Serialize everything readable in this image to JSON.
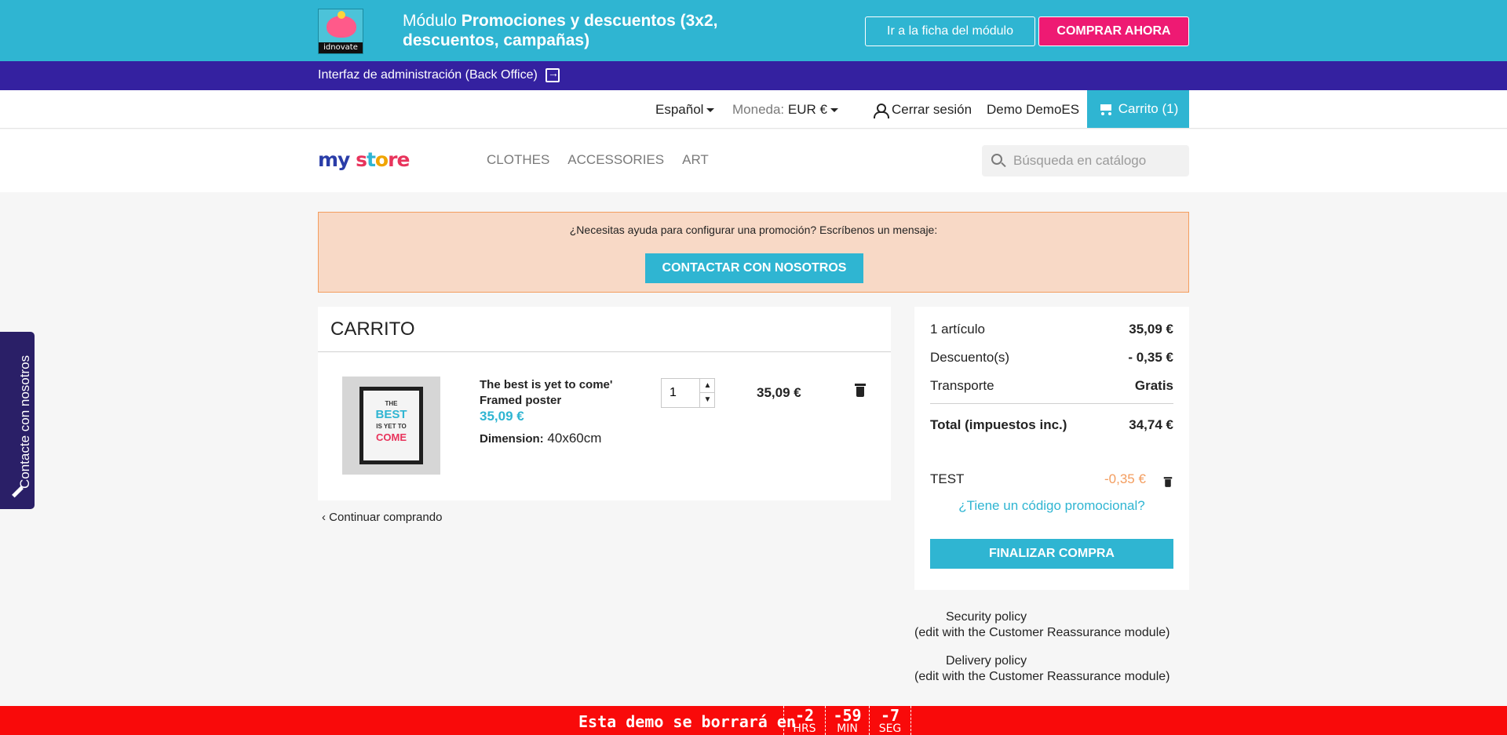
{
  "demo_banner": {
    "module_logo_text": "idnovate",
    "title_prefix": "Módulo ",
    "title_bold": "Promociones y descuentos (3x2, descuentos, campañas)",
    "module_button": "Ir a la ficha del módulo",
    "buy_button": "COMPRAR AHORA"
  },
  "backoffice": {
    "label": "Interfaz de administración (Back Office)"
  },
  "nav": {
    "language": "Español",
    "currency_label": "Moneda:",
    "currency_value": "EUR €",
    "logout": "Cerrar sesión",
    "account": "Demo DemoES",
    "cart": "Carrito (1)"
  },
  "header": {
    "logo_my": "my",
    "logo_s": "s",
    "logo_t": "t",
    "logo_o": "o",
    "logo_re": "re",
    "menu": [
      "CLOTHES",
      "ACCESSORIES",
      "ART"
    ],
    "search_placeholder": "Búsqueda en catálogo"
  },
  "help": {
    "message": "¿Necesitas ayuda para configurar una promoción? Escríbenos un mensaje:",
    "button": "CONTACTAR CON NOSOTROS"
  },
  "cart": {
    "title": "CARRITO",
    "items": [
      {
        "name": "The best is yet to come' Framed poster",
        "price": "35,09 €",
        "attribute_label": "Dimension:",
        "attribute_value": "40x60cm",
        "quantity": "1",
        "total": "35,09 €",
        "poster_lines": [
          "THE",
          "BEST",
          "IS YET TO",
          "COME"
        ]
      }
    ],
    "continue": "Continuar comprando"
  },
  "summary": {
    "items_label": "1 artículo",
    "items_value": "35,09 €",
    "discount_label": "Descuento(s)",
    "discount_value": "- 0,35 €",
    "shipping_label": "Transporte",
    "shipping_value": "Gratis",
    "total_label": "Total (impuestos inc.)",
    "total_value": "34,74 €",
    "voucher_name": "TEST",
    "voucher_value": "-0,35 €",
    "promo_link": "¿Tiene un código promocional?",
    "checkout": "FINALIZAR COMPRA"
  },
  "reassurance": {
    "security_title": "Security policy",
    "security_note": "(edit with the Customer Reassurance module)",
    "delivery_title": "Delivery policy",
    "delivery_note": "(edit with the Customer Reassurance module)"
  },
  "side_tab": {
    "label": "Contacte con nosotros"
  },
  "countdown": {
    "text": "Esta demo se borrará en",
    "hours": "-2",
    "hours_label": "HRS",
    "minutes": "-59",
    "minutes_label": "MIN",
    "seconds": "-7",
    "seconds_label": "SEG"
  },
  "colors": {
    "brand": "#2fb5d2",
    "buy": "#ee1a73",
    "backoffice": "#3421a0",
    "countdown": "#f90a0a",
    "help_bg": "#f8d9c6"
  }
}
